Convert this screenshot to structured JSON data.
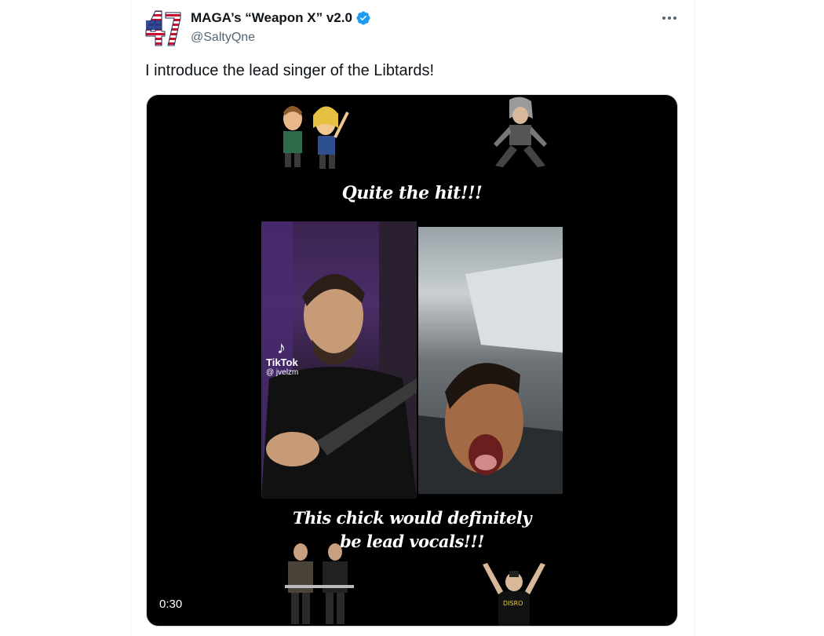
{
  "tweet": {
    "display_name": "MAGA’s “Weapon X” v2.0",
    "handle": "@SaltyQne",
    "text": "I introduce the lead singer of the Libtards!",
    "verified": true
  },
  "media": {
    "caption_top": "Quite the hit!!!",
    "caption_bottom_line1": "This chick would definitely",
    "caption_bottom_line2": "be lead vocals!!!",
    "tiktok_label": "TikTok",
    "tiktok_user": "@ jvelzm",
    "duration": "0:30"
  },
  "icons": {
    "avatar": "avatar-47-flag-icon",
    "verified": "verified-badge-icon",
    "more": "more-options-icon"
  },
  "colors": {
    "verified_blue": "#1d9bf0",
    "text_primary": "#0f1419",
    "text_secondary": "#536471",
    "media_bg": "#000000"
  }
}
